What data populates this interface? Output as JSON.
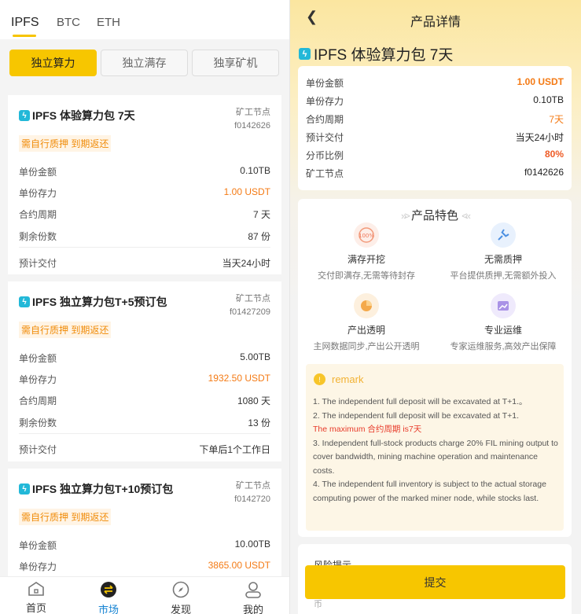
{
  "market": {
    "coin_tabs": [
      "IPFS",
      "BTC",
      "ETH"
    ],
    "segments": [
      "独立算力",
      "独立满存",
      "独享矿机"
    ],
    "cards": [
      {
        "title": "IPFS 体验算力包 7天",
        "miner_label": "矿工节点",
        "miner_id": "f0142626",
        "pledge_note": "需自行质押 到期返还",
        "rows": [
          {
            "label": "单份金额",
            "value": "0.10TB"
          },
          {
            "label": "单份存力",
            "value": "1.00 USDT"
          },
          {
            "label": "合约周期",
            "value": "7 天"
          },
          {
            "label": "剩余份数",
            "value": "87 份"
          },
          {
            "label": "预计交付",
            "value": "当天24小时"
          }
        ]
      },
      {
        "title": "IPFS 独立算力包T+5预订包",
        "miner_label": "矿工节点",
        "miner_id": "f01427209",
        "pledge_note": "需自行质押 到期返还",
        "rows": [
          {
            "label": "单份金额",
            "value": "5.00TB"
          },
          {
            "label": "单份存力",
            "value": "1932.50 USDT"
          },
          {
            "label": "合约周期",
            "value": "1080 天"
          },
          {
            "label": "剩余份数",
            "value": "13 份"
          },
          {
            "label": "预计交付",
            "value": "下单后1个工作日"
          }
        ]
      },
      {
        "title": "IPFS 独立算力包T+10预订包",
        "miner_label": "矿工节点",
        "miner_id": "f0142720",
        "pledge_note": "需自行质押 到期返还",
        "rows": [
          {
            "label": "单份金额",
            "value": "10.00TB"
          },
          {
            "label": "单份存力",
            "value": "3865.00 USDT"
          }
        ]
      }
    ],
    "nav": [
      "首页",
      "市场",
      "发现",
      "我的"
    ]
  },
  "detail": {
    "page_title": "产品详情",
    "product_name": "IPFS 体验算力包 7天",
    "rows": [
      {
        "label": "单份金额",
        "value": "1.00 USDT"
      },
      {
        "label": "单份存力",
        "value": "0.10TB"
      },
      {
        "label": "合约周期",
        "value": "7天"
      },
      {
        "label": "预计交付",
        "value": "当天24小时"
      },
      {
        "label": "分币比例",
        "value": "80%"
      },
      {
        "label": "矿工节点",
        "value": "f0142626"
      }
    ],
    "features_title": "产品特色",
    "features": [
      {
        "title": "满存开挖",
        "desc": "交付即满存,无需等待封存"
      },
      {
        "title": "无需质押",
        "desc": "平台提供质押,无需额外投入"
      },
      {
        "title": "产出透明",
        "desc": "主网数据同步,产出公开透明"
      },
      {
        "title": "专业运维",
        "desc": "专家运维服务,高效产出保障"
      }
    ],
    "remark_title": "remark",
    "remark_lines": {
      "l1": "1. The independent full deposit will be excavated at T+1.。",
      "l2": "2. The independent full deposit will be excavated at T+1.",
      "l3": "The maximum 合约周期 is7天",
      "l4": "3. Independent full-stock products charge 20% FIL mining output to cover bandwidth, mining machine operation and maintenance costs.",
      "l5": "4. The independent full inventory is subject to the actual storage computing power of the marked miner node, while stocks last."
    },
    "risk_title": "风险提示",
    "risk_text": "还是法币角度，本产品不对合约产出做任何承诺，因挖矿难度、币",
    "submit_label": "提交"
  },
  "colors": {
    "accent": "#f7c600",
    "orange": "#f47a14",
    "nav_active": "#1784d3"
  }
}
